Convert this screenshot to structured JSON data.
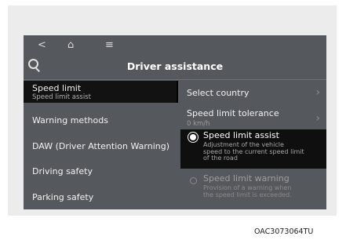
{
  "topbar": {
    "back_icon": "<",
    "home_icon": "⌂",
    "menu_icon": "≡"
  },
  "header": {
    "title": "Driver assistance",
    "search_icon": "search"
  },
  "left_menu": [
    {
      "label": "Speed limit",
      "sublabel": "Speed limit assist",
      "selected": true
    },
    {
      "label": "Warning methods"
    },
    {
      "label": "DAW (Driver Attention Warning)"
    },
    {
      "label": "Driving safety"
    },
    {
      "label": "Parking safety"
    }
  ],
  "right_panel": {
    "select_country": "Select country",
    "speed_limit_tolerance": "Speed limit tolerance",
    "tolerance_value": "0 km/h",
    "options": [
      {
        "label": "Speed limit assist",
        "description_lines": [
          "Adjustment of the vehicle",
          "speed to the current speed limit",
          "of the road"
        ],
        "selected": true
      },
      {
        "label": "Speed limit warning",
        "description_lines": [
          "Provision of a warning when",
          "the speed limit is exceeded."
        ],
        "selected": false
      }
    ]
  },
  "caption": "OAC3073064TU"
}
